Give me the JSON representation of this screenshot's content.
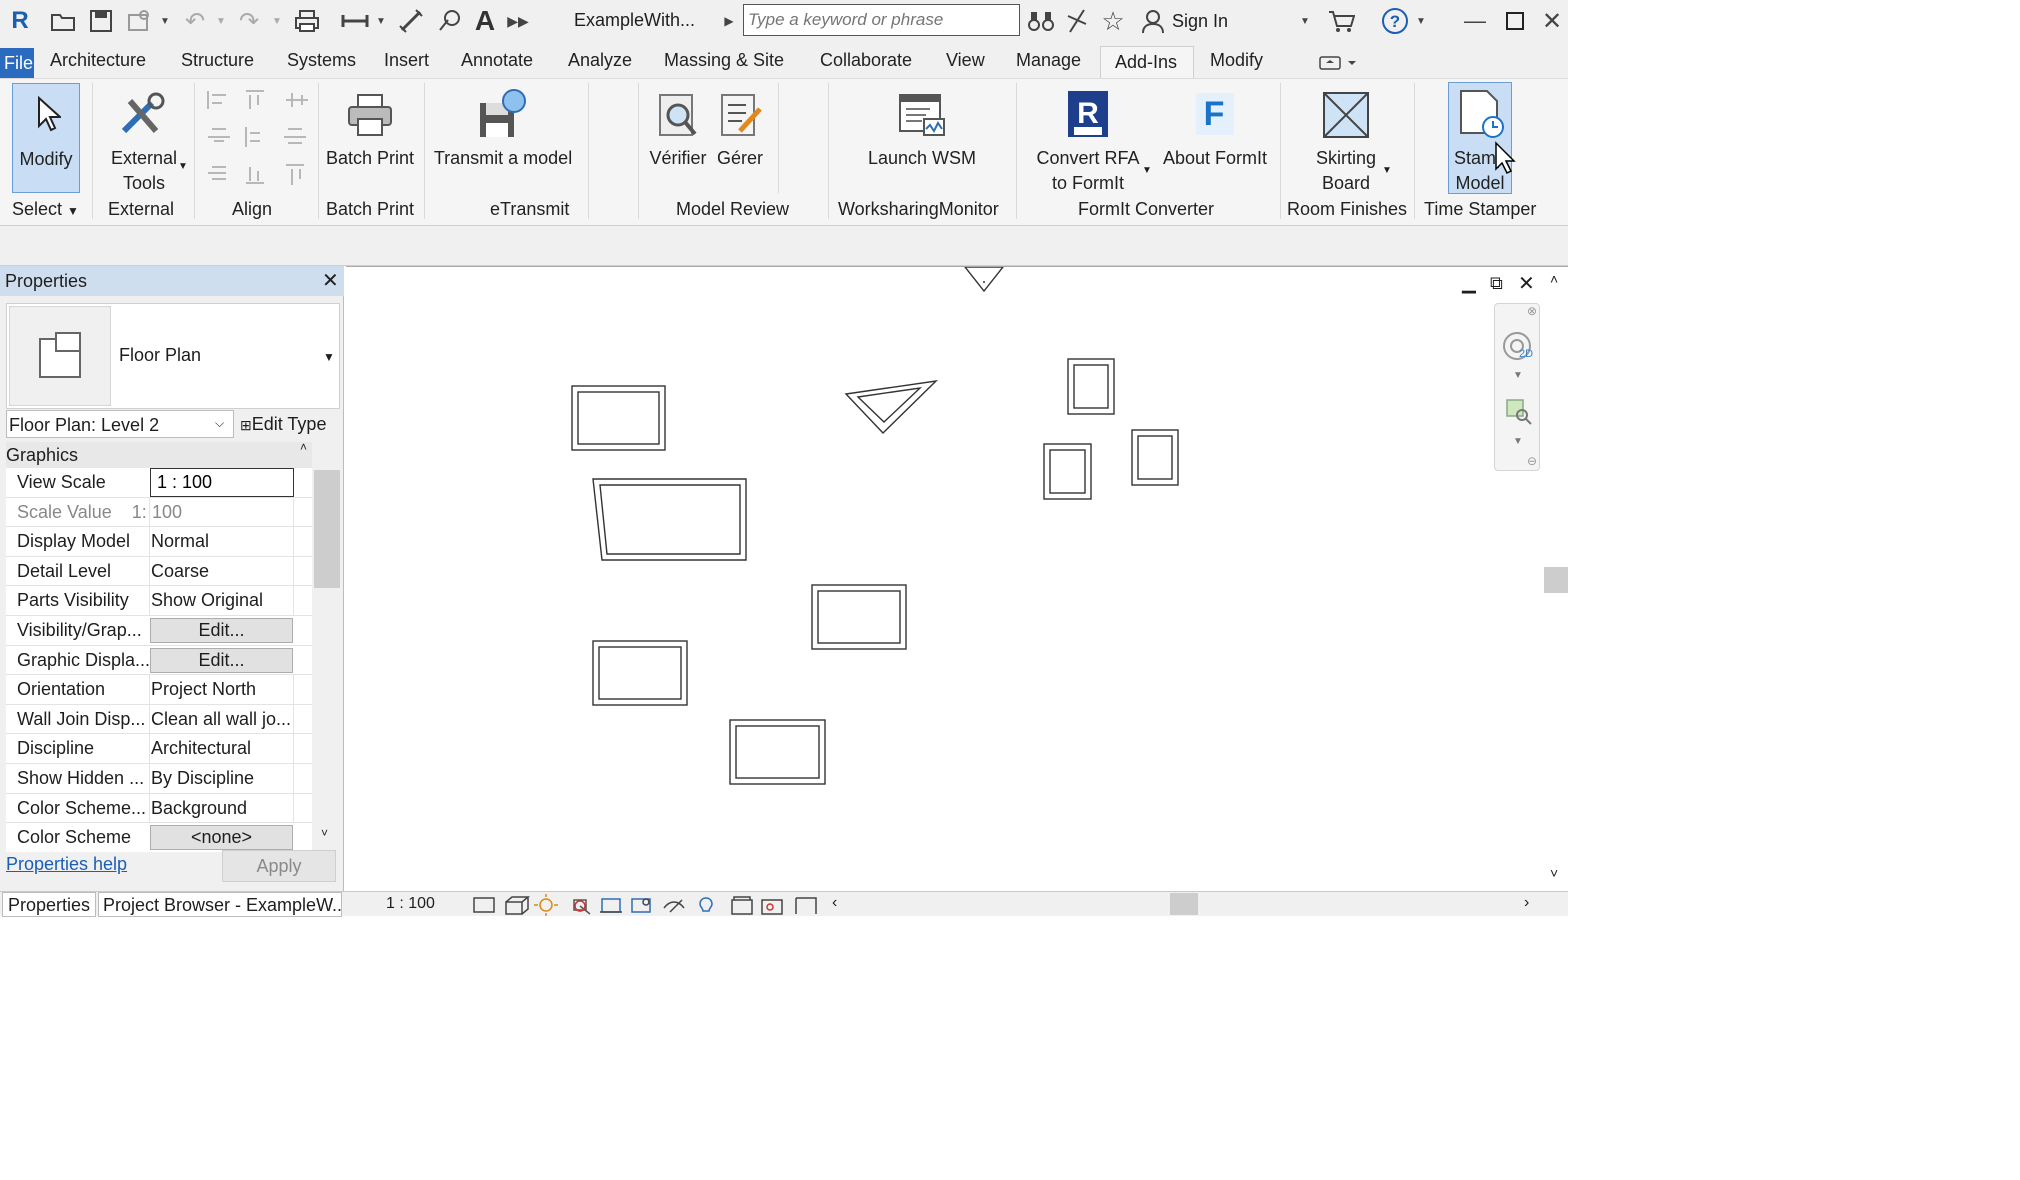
{
  "app": {
    "title": "ExampleWith...",
    "search_placeholder": "Type a keyword or phrase",
    "sign_in": "Sign In",
    "logo": "R"
  },
  "tabs": [
    {
      "label": "File",
      "active": false
    },
    {
      "label": "Architecture"
    },
    {
      "label": "Structure"
    },
    {
      "label": "Systems"
    },
    {
      "label": "Insert"
    },
    {
      "label": "Annotate"
    },
    {
      "label": "Analyze"
    },
    {
      "label": "Massing & Site"
    },
    {
      "label": "Collaborate"
    },
    {
      "label": "View"
    },
    {
      "label": "Manage"
    },
    {
      "label": "Add-Ins",
      "active": true
    },
    {
      "label": "Modify"
    }
  ],
  "ribbon": {
    "buttons": {
      "modify": "Modify",
      "external_tools_1": "External",
      "external_tools_2": "Tools",
      "batch_print": "Batch Print",
      "transmit": "Transmit a model",
      "verifier": "Vérifier",
      "gerer": "Gérer",
      "launch_wsm": "Launch WSM",
      "convert_rfa_1": "Convert RFA",
      "convert_rfa_2": "to FormIt",
      "about_formit": "About FormIt",
      "skirting_1": "Skirting",
      "skirting_2": "Board",
      "stamp_1": "Stamp",
      "stamp_2": "Model"
    },
    "panels": {
      "select": "Select",
      "external": "External",
      "align": "Align",
      "batch_print": "Batch Print",
      "etransmit": "eTransmit",
      "model_review": "Model Review",
      "worksharing": "WorksharingMonitor",
      "formit": "FormIt Converter",
      "room_finishes": "Room Finishes",
      "time_stamper": "Time Stamper"
    }
  },
  "properties": {
    "title": "Properties",
    "type_name": "Floor Plan",
    "instance_selector": "Floor Plan: Level 2",
    "edit_type": "Edit Type",
    "group": "Graphics",
    "rows": [
      {
        "name": "View Scale",
        "value": "1 : 100"
      },
      {
        "name": "Scale Value    1:",
        "value": "100"
      },
      {
        "name": "Display Model",
        "value": "Normal"
      },
      {
        "name": "Detail Level",
        "value": "Coarse"
      },
      {
        "name": "Parts Visibility",
        "value": "Show Original"
      },
      {
        "name": "Visibility/Grap...",
        "value": "Edit..."
      },
      {
        "name": "Graphic Displa...",
        "value": "Edit..."
      },
      {
        "name": "Orientation",
        "value": "Project North"
      },
      {
        "name": "Wall Join Disp...",
        "value": "Clean all wall jo..."
      },
      {
        "name": "Discipline",
        "value": "Architectural"
      },
      {
        "name": "Show Hidden ...",
        "value": "By Discipline"
      },
      {
        "name": "Color Scheme...",
        "value": "Background"
      },
      {
        "name": "Color Scheme",
        "value": "<none>"
      }
    ],
    "help_link": "Properties help",
    "apply": "Apply"
  },
  "bottom_tabs": [
    {
      "label": "Properties"
    },
    {
      "label": "Project Browser - ExampleW..."
    }
  ],
  "status": {
    "scale": "1 : 100"
  },
  "nav_bar": {
    "mode": "2D"
  }
}
